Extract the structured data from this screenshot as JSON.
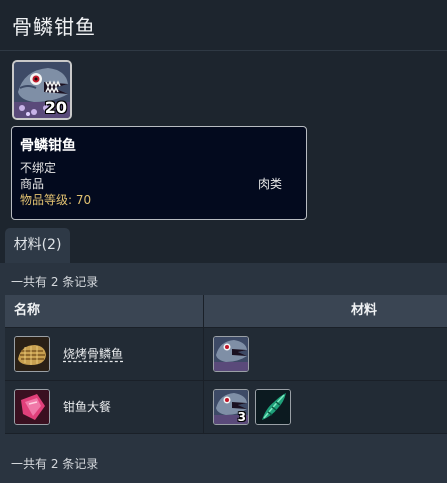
{
  "page": {
    "title": "骨鳞钳鱼"
  },
  "item": {
    "stack_count": "20",
    "icon": "fish-icon",
    "tooltip": {
      "name": "骨鳞钳鱼",
      "bind": "不绑定",
      "type": "商品",
      "subtype": "肉类",
      "level_label": "物品等级: 70"
    }
  },
  "tabs": [
    {
      "label": "材料(2)"
    }
  ],
  "table": {
    "summary_top": "一共有 2 条记录",
    "summary_bottom": "一共有 2 条记录",
    "headers": {
      "name": "名称",
      "materials": "材料"
    },
    "rows": [
      {
        "name": "烧烤骨鳞鱼",
        "icon": "grilled-fish-icon",
        "materials": [
          {
            "icon": "fish-icon",
            "count": ""
          }
        ]
      },
      {
        "name": "钳鱼大餐",
        "icon": "pink-feast-icon",
        "materials": [
          {
            "icon": "fish-icon",
            "count": "3"
          },
          {
            "icon": "green-herb-icon",
            "count": ""
          }
        ]
      }
    ]
  },
  "colors": {
    "background": "#1d252e",
    "panel": "#2a3440",
    "tooltip_bg": "#030a1e",
    "level_text": "#e0c070"
  }
}
